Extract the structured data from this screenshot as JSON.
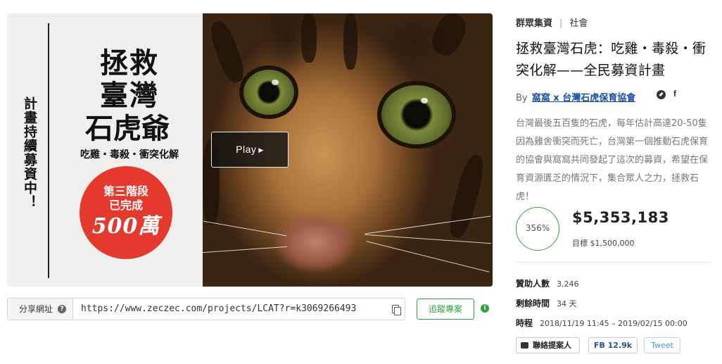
{
  "hero": {
    "poster": {
      "side_text": "計畫持續募資中！",
      "title_line1": "拯救",
      "title_line2": "臺灣",
      "title_line3": "石虎爺",
      "subtitle": "吃雞・毒殺・衝突化解",
      "badge_line1": "第三階段",
      "badge_line2": "已完成",
      "badge_line3": "500萬"
    },
    "play_label": "Play"
  },
  "share": {
    "label": "分享網址",
    "url": "https://www.zeczec.com/projects/LCAT?r=k3069266493",
    "follow_label": "追蹤專案"
  },
  "project": {
    "platform": "群眾集資",
    "category": "社會",
    "title": "拯救臺灣石虎：吃雞・毒殺・衝突化解——全民募資計畫",
    "by_label": "By",
    "creator": "窩窩 x 台灣石虎保育協會",
    "fb_letter": "f",
    "description": "台灣最後五百隻的石虎，每年估計高達20-50隻因為雞舍衝突而死亡，台灣第一個推動石虎保育的協會與窩窩共同發起了這次的募資，希望在保育資源匱乏的情況下，集合眾人之力，拯救石虎！",
    "percent": "356%",
    "amount": "$5,353,183",
    "goal": "目標 $1,500,000",
    "backers_label": "贊助人數",
    "backers": "3,246",
    "remaining_label": "剩餘時間",
    "remaining": "34 天",
    "period_label": "時程",
    "period": "2018/11/19 11:45 – 2019/02/15 00:00",
    "contact_label": "聯絡提案人",
    "fb_share": "FB  12.9k",
    "tweet_label": "Tweet"
  },
  "colors": {
    "accent_green": "#2ea343",
    "link_blue": "#1d4fa8",
    "badge_red": "#e43a2d"
  }
}
